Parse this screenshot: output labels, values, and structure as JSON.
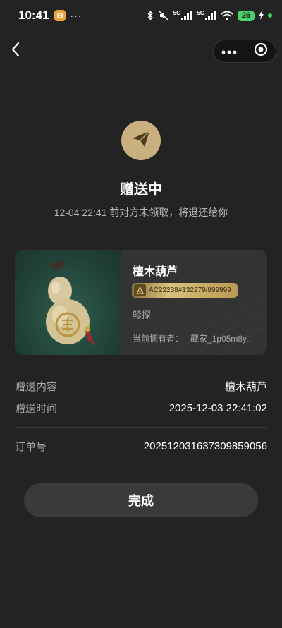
{
  "status_bar": {
    "time": "10:41",
    "dots": "···",
    "network_label_1": "5G",
    "network_label_2": "5G",
    "battery": "26",
    "icons": [
      "bluetooth-icon",
      "mute-icon",
      "signal-icon",
      "signal-icon",
      "wifi-icon",
      "battery-icon",
      "charging-icon"
    ]
  },
  "nav": {
    "back_icon": "chevron-left-icon",
    "more_icon": "more-dots-icon",
    "close_icon": "target-circle-icon"
  },
  "hero": {
    "icon": "paper-plane-icon",
    "title": "赠送中",
    "subtitle": "12-04 22:41 前对方未领取，将退还给你",
    "accent_color": "#cbb07f"
  },
  "item": {
    "name": "檀木葫芦",
    "serial": "AC22238#132279/999999",
    "issuer": "鲸探",
    "owner_label": "当前拥有者：",
    "owner_value": "藏家_1p05m8y..."
  },
  "details": {
    "content_label": "赠送内容",
    "content_value": "檀木葫芦",
    "time_label": "赠送时间",
    "time_value": "2025-12-03 22:41:02",
    "order_label": "订单号",
    "order_value": "20251203163730985905​6"
  },
  "actions": {
    "done_label": "完成"
  }
}
